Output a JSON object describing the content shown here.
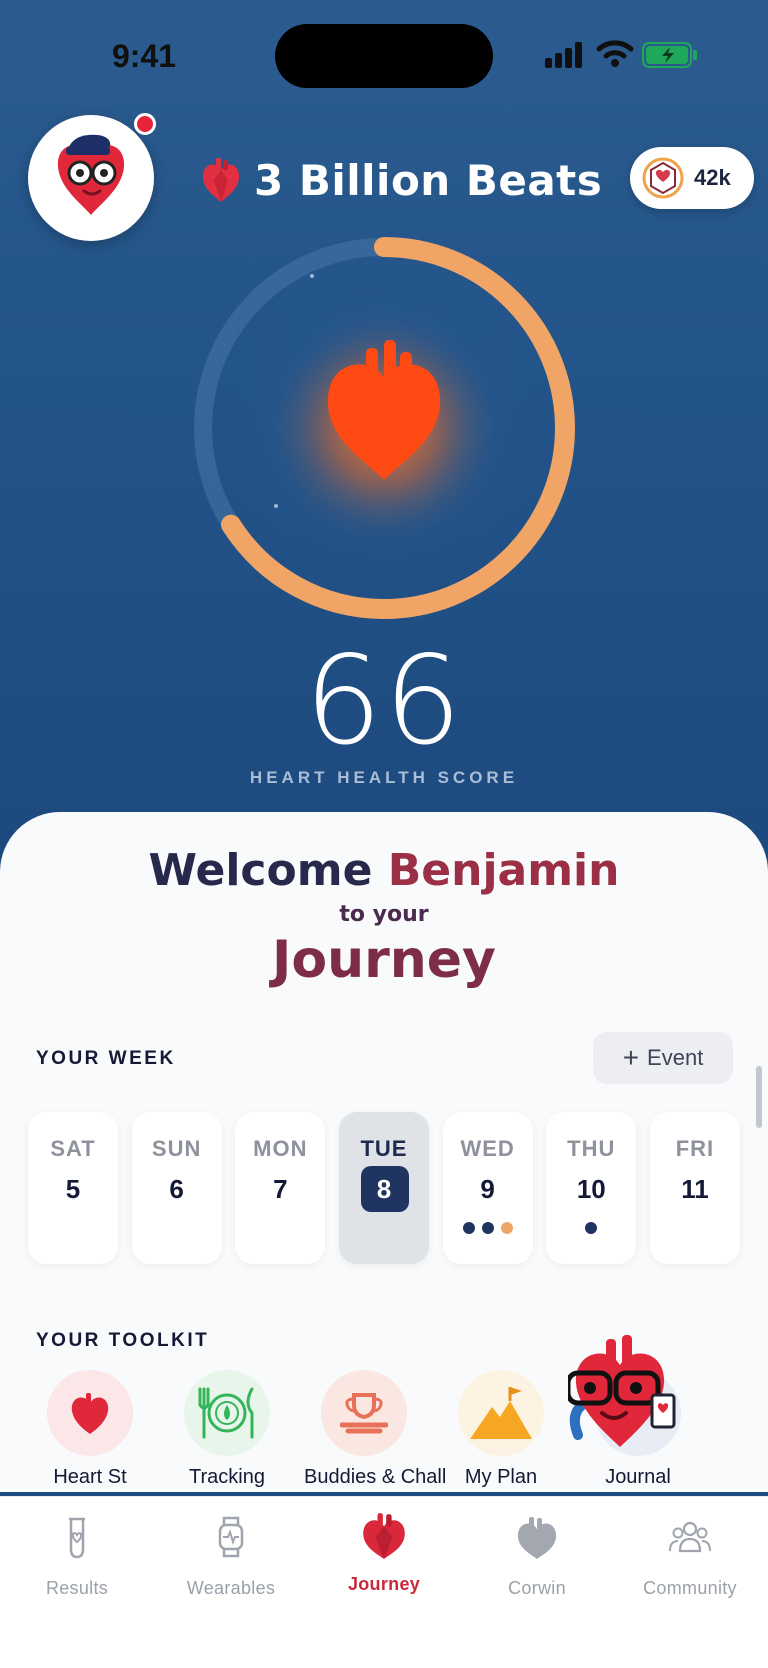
{
  "status": {
    "time": "9:41"
  },
  "header": {
    "title": "3 Billion Beats",
    "points": "42k"
  },
  "score": {
    "value": "66",
    "label": "HEART HEALTH SCORE",
    "progress": 0.66
  },
  "welcome": {
    "line1": "Welcome",
    "name": "Benjamin",
    "line2": "to your",
    "line3": "Journey"
  },
  "week": {
    "title": "YOUR WEEK",
    "event_label": "Event",
    "days": [
      {
        "name": "SAT",
        "date": "5",
        "dots": []
      },
      {
        "name": "SUN",
        "date": "6",
        "dots": []
      },
      {
        "name": "MON",
        "date": "7",
        "dots": []
      },
      {
        "name": "TUE",
        "date": "8",
        "dots": [],
        "selected": true
      },
      {
        "name": "WED",
        "date": "9",
        "dots": [
          "navy",
          "navy",
          "orange"
        ]
      },
      {
        "name": "THU",
        "date": "10",
        "dots": [
          "navy"
        ]
      },
      {
        "name": "FRI",
        "date": "11",
        "dots": []
      }
    ]
  },
  "toolkit": {
    "title": "YOUR TOOLKIT",
    "items": [
      {
        "label": "Heart St",
        "icon": "heart-icon"
      },
      {
        "label": "Tracking",
        "icon": "plate-icon"
      },
      {
        "label": "Buddies & Chall",
        "icon": "trophy-icon"
      },
      {
        "label": "My Plan",
        "icon": "mountain-flag-icon"
      },
      {
        "label": "Journal",
        "icon": "journal-icon"
      }
    ]
  },
  "tabs": [
    {
      "label": "Results",
      "icon": "test-tube-icon"
    },
    {
      "label": "Wearables",
      "icon": "watch-icon"
    },
    {
      "label": "Journey",
      "icon": "heart-icon",
      "active": true
    },
    {
      "label": "Corwin",
      "icon": "mascot-icon"
    },
    {
      "label": "Community",
      "icon": "people-icon"
    }
  ],
  "colors": {
    "accent": "#c82a3b",
    "navy": "#1f3460",
    "ring": "#f0a567"
  }
}
